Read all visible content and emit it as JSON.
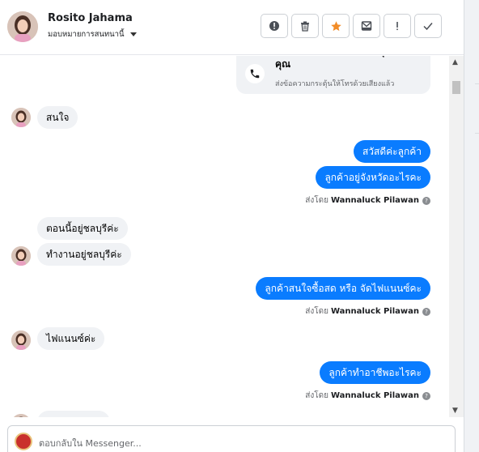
{
  "header": {
    "contact_name": "Rosito Jahama",
    "assign_label": "มอบหมายการสนทนานี้",
    "actions": [
      {
        "icon": "alert-circle-icon",
        "glyph": "!"
      },
      {
        "icon": "trash-icon",
        "glyph": "🗑"
      },
      {
        "icon": "star-icon",
        "glyph": "★"
      },
      {
        "icon": "archive-mail-icon",
        "glyph": "✉"
      },
      {
        "icon": "exclamation-icon",
        "glyph": "!"
      },
      {
        "icon": "check-icon",
        "glyph": "✓"
      }
    ]
  },
  "call_card": {
    "title": "โทรหารถยนต์มืองอ โชคคุณ โชคดีคุณ",
    "subtitle": "ส่งข้อความกระตุ้นให้โทรด้วยเสียงแล้ว"
  },
  "messages": {
    "m1": "สนใจ",
    "m2": "สวัสดีค่ะลูกค้า",
    "m3": "ลูกค้าอยู่จังหวัดอะไรคะ",
    "m4": "ตอนนี้อยู่ชลบุรีค่ะ",
    "m5": "ทำงานอยู่ชลบุรีค่ะ",
    "m6": "ลูกค้าสนใจซื้อสด หรือ จัดไฟแนนซ์คะ",
    "m7": "ไฟแนนซ์ค่ะ",
    "m8": "ลูกค้าทำอาชีพอะไรคะ"
  },
  "sent_by": {
    "prefix": "ส่งโดย",
    "agent": "Wannaluck Pilawan",
    "help": "?"
  },
  "composer": {
    "placeholder": "ตอบกลับใน Messenger..."
  },
  "colors": {
    "outgoing_bubble": "#0a7cff",
    "incoming_bubble": "#f0f2f5",
    "star_accent": "#f28c28"
  }
}
